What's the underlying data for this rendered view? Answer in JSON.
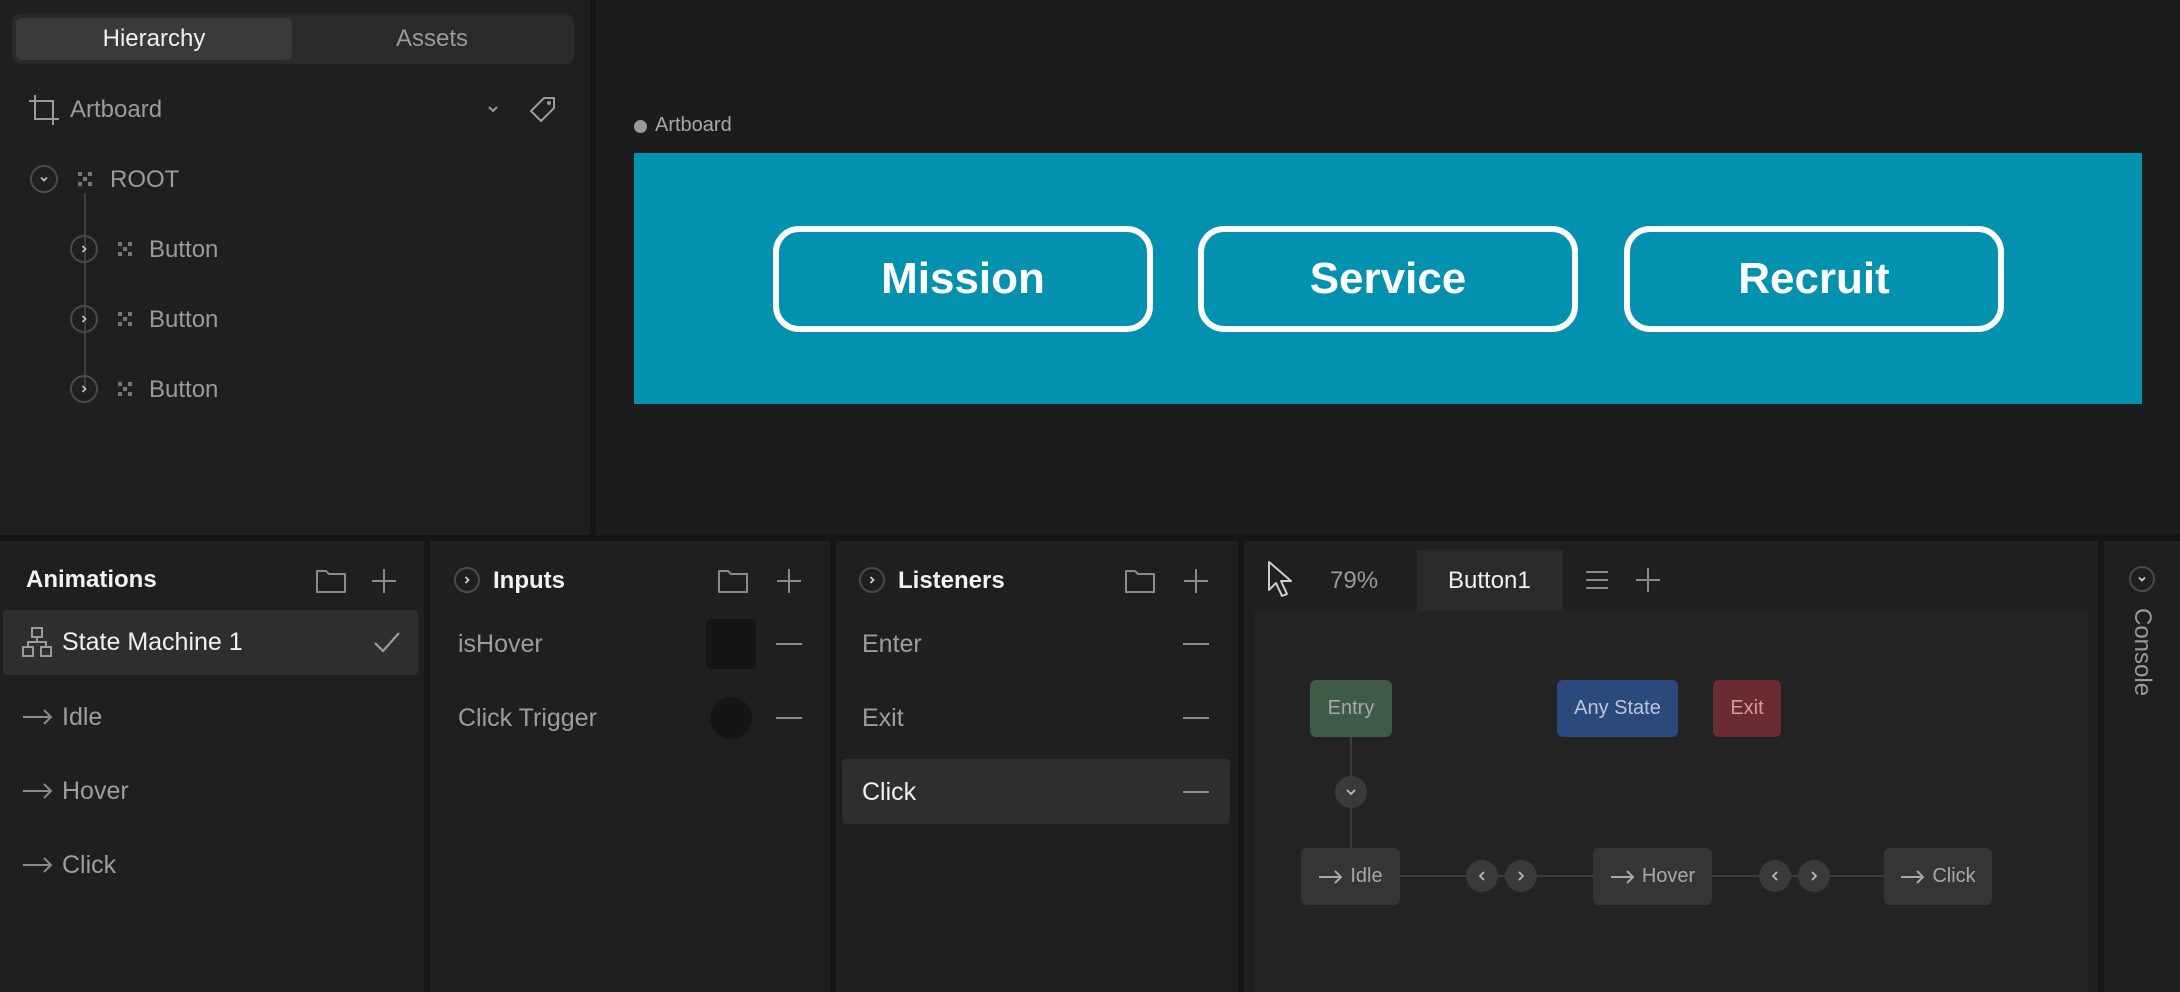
{
  "hierarchy": {
    "tabs": [
      "Hierarchy",
      "Assets"
    ],
    "artboard_label": "Artboard",
    "root_label": "ROOT",
    "children": [
      "Button",
      "Button",
      "Button"
    ]
  },
  "canvas": {
    "artboard_name": "Artboard",
    "artboard_color": "#0291ae",
    "buttons": [
      "Mission",
      "Service",
      "Recruit"
    ]
  },
  "animations": {
    "title": "Animations",
    "selected": "State Machine 1",
    "items": [
      "Idle",
      "Hover",
      "Click"
    ]
  },
  "inputs": {
    "title": "Inputs",
    "items": [
      "isHover",
      "Click Trigger"
    ]
  },
  "listeners": {
    "title": "Listeners",
    "items": [
      "Enter",
      "Exit",
      "Click"
    ],
    "selected": "Click"
  },
  "state_machine": {
    "zoom": "79%",
    "tab": "Button1",
    "nodes": {
      "entry": "Entry",
      "any_state": "Any State",
      "exit": "Exit",
      "idle": "Idle",
      "hover": "Hover",
      "click": "Click"
    },
    "colors": {
      "entry": "#3e5a48",
      "any_state": "#2a4a7e",
      "exit": "#6a2b31"
    }
  },
  "console": {
    "label": "Console"
  }
}
